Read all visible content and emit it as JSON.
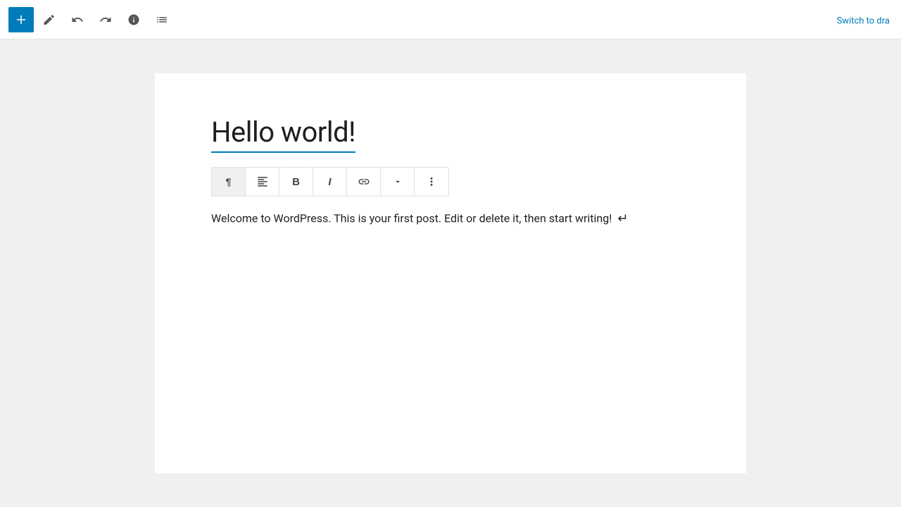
{
  "toolbar": {
    "add_label": "+",
    "switch_to_label": "Switch to dra",
    "switch_to_full": "Switch to draft"
  },
  "editor": {
    "post_title": "Hello world!",
    "paragraph": "Welcome to WordPress. This is your first post. Edit or delete it, then start writing!"
  },
  "block_toolbar": {
    "paragraph_icon": "¶",
    "align_icon": "≡",
    "bold_icon": "B",
    "italic_icon": "I",
    "link_icon": "🔗",
    "chevron_icon": "∨",
    "more_icon": "⋮"
  }
}
